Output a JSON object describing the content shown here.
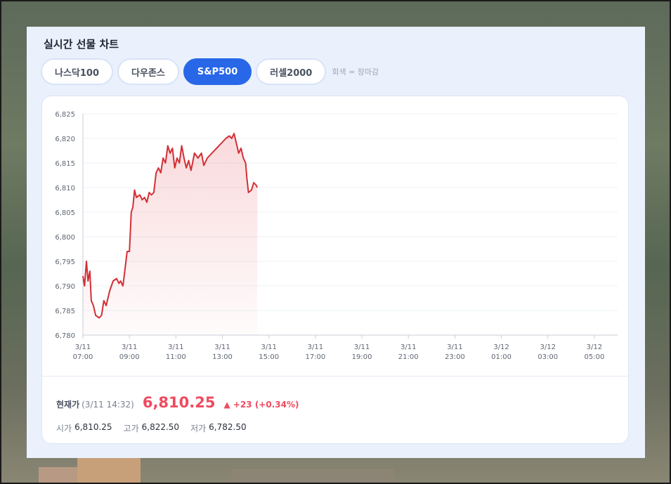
{
  "title": "실시간 선물 차트",
  "tabs": [
    {
      "label": "나스닥100",
      "active": false
    },
    {
      "label": "다우존스",
      "active": false
    },
    {
      "label": "S&P500",
      "active": true
    },
    {
      "label": "러셀2000",
      "active": false
    }
  ],
  "note": "회색 = 장마감",
  "colors": {
    "accent": "#2867e8",
    "line": "#d32f35",
    "up": "#ee4b5f"
  },
  "current": {
    "label": "현재가",
    "time": "(3/11 14:32)",
    "price": "6,810.25",
    "change": "▲ +23 (+0.34%)"
  },
  "ohl": {
    "open_label": "시가",
    "open": "6,810.25",
    "high_label": "고가",
    "high": "6,822.50",
    "low_label": "저가",
    "low": "6,782.50"
  },
  "chart_data": {
    "type": "area",
    "ylim": [
      6780,
      6825
    ],
    "yticks": [
      "6,825",
      "6,820",
      "6,815",
      "6,810",
      "6,805",
      "6,800",
      "6,795",
      "6,790",
      "6,785",
      "6,780"
    ],
    "ytick_values": [
      6825,
      6820,
      6815,
      6810,
      6805,
      6800,
      6795,
      6790,
      6785,
      6780
    ],
    "xlim_hours": [
      7,
      30
    ],
    "xticks": [
      {
        "date": "3/11",
        "time": "07:00",
        "h": 7
      },
      {
        "date": "3/11",
        "time": "09:00",
        "h": 9
      },
      {
        "date": "3/11",
        "time": "11:00",
        "h": 11
      },
      {
        "date": "3/11",
        "time": "13:00",
        "h": 13
      },
      {
        "date": "3/11",
        "time": "15:00",
        "h": 15
      },
      {
        "date": "3/11",
        "time": "17:00",
        "h": 17
      },
      {
        "date": "3/11",
        "time": "19:00",
        "h": 19
      },
      {
        "date": "3/11",
        "time": "21:00",
        "h": 21
      },
      {
        "date": "3/11",
        "time": "23:00",
        "h": 23
      },
      {
        "date": "3/12",
        "time": "01:00",
        "h": 25
      },
      {
        "date": "3/12",
        "time": "03:00",
        "h": 27
      },
      {
        "date": "3/12",
        "time": "05:00",
        "h": 29
      }
    ],
    "grid": true,
    "series": [
      {
        "points": [
          [
            7.0,
            6792
          ],
          [
            7.07,
            6790
          ],
          [
            7.15,
            6795
          ],
          [
            7.22,
            6791
          ],
          [
            7.3,
            6793
          ],
          [
            7.36,
            6787
          ],
          [
            7.45,
            6786
          ],
          [
            7.55,
            6784
          ],
          [
            7.7,
            6783.5
          ],
          [
            7.8,
            6784
          ],
          [
            7.9,
            6787
          ],
          [
            8.0,
            6786
          ],
          [
            8.15,
            6789
          ],
          [
            8.3,
            6791
          ],
          [
            8.45,
            6791.5
          ],
          [
            8.55,
            6790.5
          ],
          [
            8.62,
            6791
          ],
          [
            8.72,
            6790
          ],
          [
            8.8,
            6793
          ],
          [
            8.9,
            6797
          ],
          [
            9.0,
            6797
          ],
          [
            9.08,
            6805
          ],
          [
            9.15,
            6806
          ],
          [
            9.22,
            6809.5
          ],
          [
            9.3,
            6808
          ],
          [
            9.45,
            6808.5
          ],
          [
            9.55,
            6807.5
          ],
          [
            9.65,
            6808
          ],
          [
            9.75,
            6807
          ],
          [
            9.85,
            6809
          ],
          [
            9.95,
            6808.5
          ],
          [
            10.05,
            6809
          ],
          [
            10.15,
            6813
          ],
          [
            10.25,
            6814
          ],
          [
            10.35,
            6813
          ],
          [
            10.45,
            6816
          ],
          [
            10.55,
            6815
          ],
          [
            10.65,
            6818.5
          ],
          [
            10.75,
            6817
          ],
          [
            10.85,
            6818
          ],
          [
            10.95,
            6814
          ],
          [
            11.05,
            6816
          ],
          [
            11.15,
            6815
          ],
          [
            11.25,
            6818.5
          ],
          [
            11.35,
            6816
          ],
          [
            11.45,
            6814
          ],
          [
            11.55,
            6815.5
          ],
          [
            11.65,
            6813.5
          ],
          [
            11.8,
            6817
          ],
          [
            11.95,
            6816
          ],
          [
            12.1,
            6817
          ],
          [
            12.2,
            6814.5
          ],
          [
            12.35,
            6816
          ],
          [
            12.55,
            6817
          ],
          [
            12.75,
            6818
          ],
          [
            12.95,
            6819
          ],
          [
            13.15,
            6820
          ],
          [
            13.3,
            6820.5
          ],
          [
            13.4,
            6820
          ],
          [
            13.5,
            6821
          ],
          [
            13.6,
            6819
          ],
          [
            13.7,
            6817
          ],
          [
            13.8,
            6818
          ],
          [
            13.9,
            6816
          ],
          [
            14.0,
            6815
          ],
          [
            14.05,
            6812
          ],
          [
            14.12,
            6809
          ],
          [
            14.25,
            6809.5
          ],
          [
            14.35,
            6811
          ],
          [
            14.45,
            6810.5
          ],
          [
            14.5,
            6810
          ]
        ]
      }
    ]
  }
}
